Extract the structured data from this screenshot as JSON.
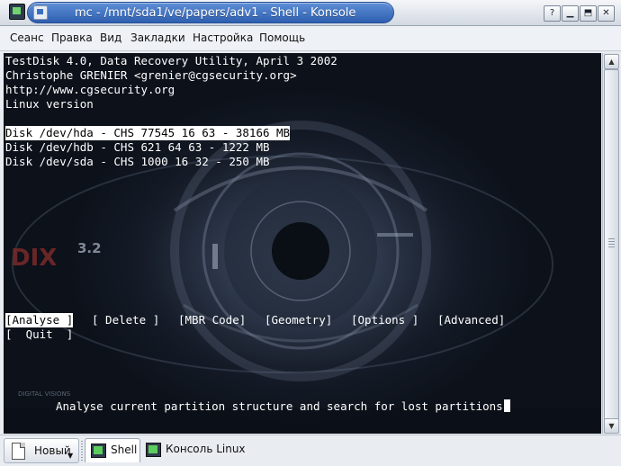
{
  "window": {
    "title": "mc - /mnt/sda1/ve/papers/adv1 - Shell - Konsole",
    "buttons": [
      "?",
      "▁",
      "⬒",
      "✕"
    ]
  },
  "menu": [
    "Сеанс",
    "Правка",
    "Вид",
    "Закладки",
    "Настройка",
    "Помощь"
  ],
  "terminal": {
    "header_lines": [
      "TestDisk 4.0, Data Recovery Utility, April 3 2002",
      "Christophe GRENIER <grenier@cgsecurity.org>",
      "http://www.cgsecurity.org",
      "Linux version"
    ],
    "disks": [
      "Disk /dev/hda - CHS 77545 16 63 - 38166 MB",
      "Disk /dev/hdb - CHS 621 64 63 - 1222 MB",
      "Disk /dev/sda - CHS 1000 16 32 - 250 MB"
    ],
    "selected_disk_index": 0,
    "actions": [
      "[Analyse ]",
      "[ Delete ]",
      "[MBR Code]",
      "[Geometry]",
      "[Options ]",
      "[Advanced]",
      "[  Quit  ]"
    ],
    "selected_action_index": 0,
    "help_text": "Analyse current partition structure and search for lost partitions",
    "wallpaper_text": {
      "logo": "DIX",
      "version": "3.2",
      "credit": "DIGITAL VISIONS"
    }
  },
  "taskbar": {
    "new_button": "Новый",
    "tabs": [
      {
        "label": "Shell",
        "active": true,
        "icon": "konsole-icon"
      },
      {
        "label": "Консоль Linux",
        "active": false,
        "icon": "konsole-icon"
      }
    ]
  },
  "colors": {
    "title_active": "#3a6fc4",
    "terminal_fg": "#ffffff",
    "highlight_bg": "#ffffff"
  }
}
